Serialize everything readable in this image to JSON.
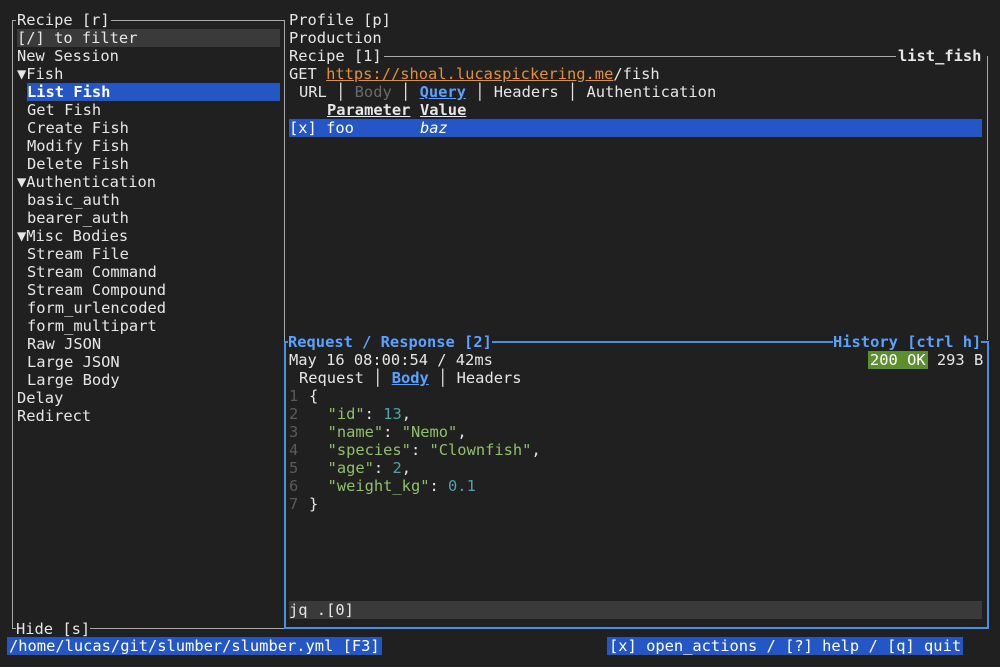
{
  "recipe_panel": {
    "title": "Recipe [r]",
    "filter_hint": "[/] to filter",
    "items": [
      {
        "label": "New Session",
        "indent": 0
      },
      {
        "label": "▼Fish",
        "indent": 0
      },
      {
        "label": "List Fish",
        "indent": 1,
        "selected": true
      },
      {
        "label": "Get Fish",
        "indent": 1
      },
      {
        "label": "Create Fish",
        "indent": 1
      },
      {
        "label": "Modify Fish",
        "indent": 1
      },
      {
        "label": "Delete Fish",
        "indent": 1
      },
      {
        "label": "▼Authentication",
        "indent": 0
      },
      {
        "label": "basic_auth",
        "indent": 1
      },
      {
        "label": "bearer_auth",
        "indent": 1
      },
      {
        "label": "▼Misc Bodies",
        "indent": 0
      },
      {
        "label": "Stream File",
        "indent": 1
      },
      {
        "label": "Stream Command",
        "indent": 1
      },
      {
        "label": "Stream Compound",
        "indent": 1
      },
      {
        "label": "form_urlencoded",
        "indent": 1
      },
      {
        "label": "form_multipart",
        "indent": 1
      },
      {
        "label": "Raw JSON",
        "indent": 1
      },
      {
        "label": "Large JSON",
        "indent": 1
      },
      {
        "label": "Large Body",
        "indent": 1
      },
      {
        "label": "Delay",
        "indent": 0
      },
      {
        "label": "Redirect",
        "indent": 0
      }
    ]
  },
  "profile": {
    "title": "Profile [p]",
    "value": "Production"
  },
  "recipe_detail": {
    "title": "Recipe [1]",
    "recipe_id": "list_fish",
    "method": "GET",
    "url_link": "https://shoal.lucaspickering.me",
    "url_path": "/fish",
    "tabs": [
      "URL",
      "Body",
      "Query",
      "Headers",
      "Authentication"
    ],
    "active_tab": "Query",
    "disabled_tab": "Body",
    "query_headers": [
      "Parameter",
      "Value"
    ],
    "query_rows": [
      {
        "toggle": "[x]",
        "param": "foo",
        "value": "baz"
      }
    ]
  },
  "response": {
    "title": "Request / Response [2]",
    "history_label": "History [ctrl h]",
    "timestamp": "May 16 08:00:54 / 42ms",
    "status": "200 OK",
    "size": "293 B",
    "tabs": [
      "Request",
      "Body",
      "Headers"
    ],
    "active_tab": "Body",
    "body_lines": [
      {
        "n": "1",
        "text": "{"
      },
      {
        "n": "2",
        "key": "\"id\"",
        "val": "13",
        "vtype": "num",
        "comma": ","
      },
      {
        "n": "3",
        "key": "\"name\"",
        "val": "\"Nemo\"",
        "vtype": "str",
        "comma": ","
      },
      {
        "n": "4",
        "key": "\"species\"",
        "val": "\"Clownfish\"",
        "vtype": "str",
        "comma": ","
      },
      {
        "n": "5",
        "key": "\"age\"",
        "val": "2",
        "vtype": "num",
        "comma": ","
      },
      {
        "n": "6",
        "key": "\"weight_kg\"",
        "val": "0.1",
        "vtype": "num",
        "comma": ""
      },
      {
        "n": "7",
        "text": "}"
      }
    ],
    "query_input": "jq .[0]"
  },
  "footer": {
    "hide_label": "Hide [s]",
    "file_path": "/home/lucas/git/slumber/slumber.yml [F3]",
    "actions": "[x] open_actions / [?] help / [q] quit"
  },
  "colors": {
    "background": "#202020",
    "selection": "#2457c5",
    "accent_blue": "#4a90e2",
    "status_ok": "#5b8f2f",
    "link": "#e0913a"
  }
}
